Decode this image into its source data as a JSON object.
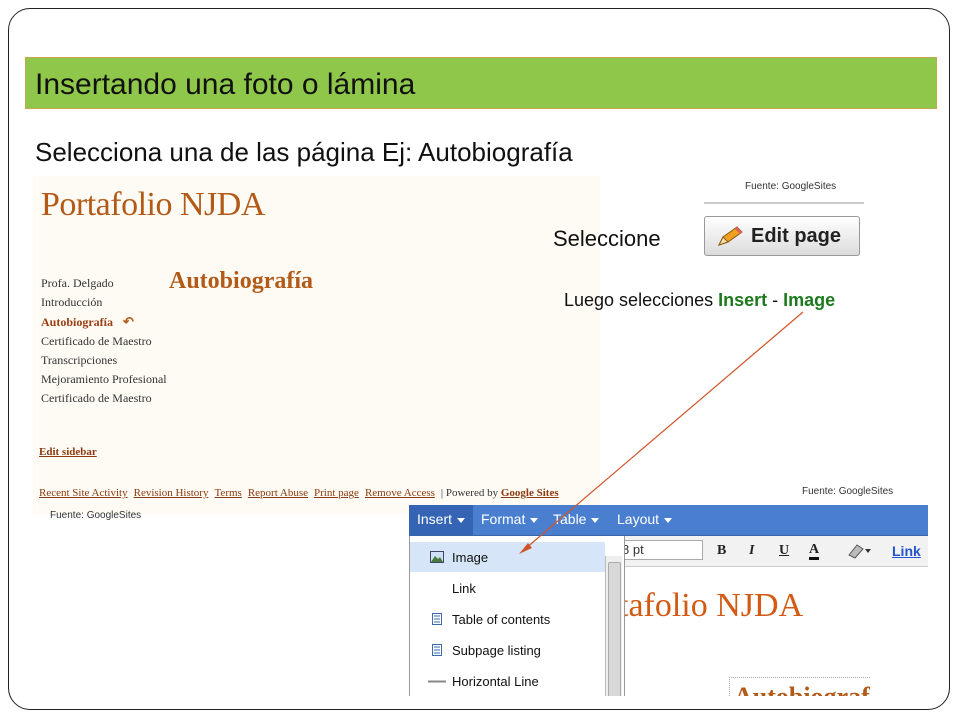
{
  "slide": {
    "title": "Insertando una foto o lámina",
    "subtitle": "Selecciona una de las página Ej: Autobiografía",
    "select_label": "Seleccione",
    "instruction": {
      "prefix": "Luego selecciones ",
      "insert": "Insert",
      "dash": " - ",
      "image": "Image"
    },
    "sources": {
      "left": "Fuente: GoogleSites",
      "edit_button": "Fuente: GoogleSites",
      "editor": "Fuente: GoogleSites"
    }
  },
  "site_screenshot": {
    "site_title": "Portafolio NJDA",
    "page_heading": "Autobiografía",
    "sidebar": [
      "Profa. Delgado",
      "Introducción",
      "Autobiografía",
      "Certificado de Maestro",
      "Transcripciones",
      "Mejoramiento Profesional",
      "Certificado de Maestro"
    ],
    "edit_sidebar": "Edit sidebar",
    "footer_links": [
      "Recent Site Activity",
      "Revision History",
      "Terms",
      "Report Abuse",
      "Print page",
      "Remove Access"
    ],
    "powered_by": "| Powered by ",
    "google_sites": "Google Sites"
  },
  "edit_button": {
    "label": "Edit page"
  },
  "editor_screenshot": {
    "menus": [
      "Insert",
      "Format",
      "Table",
      "Layout"
    ],
    "font_size": "8 pt",
    "toolbar": [
      "B",
      "I",
      "U",
      "A",
      "Link"
    ],
    "insert_menu_items": [
      "Image",
      "Link",
      "Table of contents",
      "Subpage listing",
      "Horizontal Line"
    ],
    "background_title": "tafolio NJDA",
    "background_heading": "Autobiograf"
  },
  "colors": {
    "title_bar": "#8fc74a",
    "site_accent": "#b45a18",
    "menubar": "#4a7fd0",
    "highlight_green": "#1d7a1d",
    "arrow": "#d0542a"
  }
}
